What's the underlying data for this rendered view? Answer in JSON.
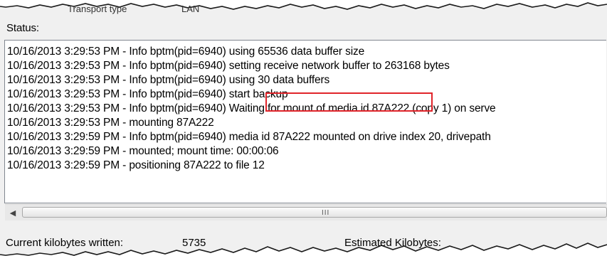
{
  "header": {
    "top_fragment": "Transport type",
    "top_fragment2": "LAN"
  },
  "status": {
    "label": "Status:",
    "log_lines": [
      "10/16/2013 3:29:53 PM - Info bptm(pid=6940) using 65536 data buffer size",
      "10/16/2013 3:29:53 PM - Info bptm(pid=6940) setting receive network buffer to 263168 bytes",
      "10/16/2013 3:29:53 PM - Info bptm(pid=6940) using 30 data buffers",
      "10/16/2013 3:29:53 PM - Info bptm(pid=6940) start backup",
      "10/16/2013 3:29:53 PM - Info bptm(pid=6940) Waiting for mount of media id 87A222 (copy 1) on serve",
      "10/16/2013 3:29:53 PM - mounting 87A222",
      "10/16/2013 3:29:59 PM - Info bptm(pid=6940) media id 87A222 mounted on drive index 20, drivepath",
      "10/16/2013 3:29:59 PM - mounted; mount time: 00:00:06",
      "10/16/2013 3:29:59 PM - positioning 87A222 to file 12"
    ]
  },
  "scrollbar": {
    "left_arrow_icon": "left-arrow-icon",
    "grip_icon": "scroll-grip-icon"
  },
  "footer": {
    "current_kb_label": "Current kilobytes written:",
    "current_kb_value": "5735",
    "estimated_kb_label": "Estimated Kilobytes:"
  },
  "colors": {
    "highlight": "#e0242a",
    "panel_bg": "#f0f0f0"
  }
}
